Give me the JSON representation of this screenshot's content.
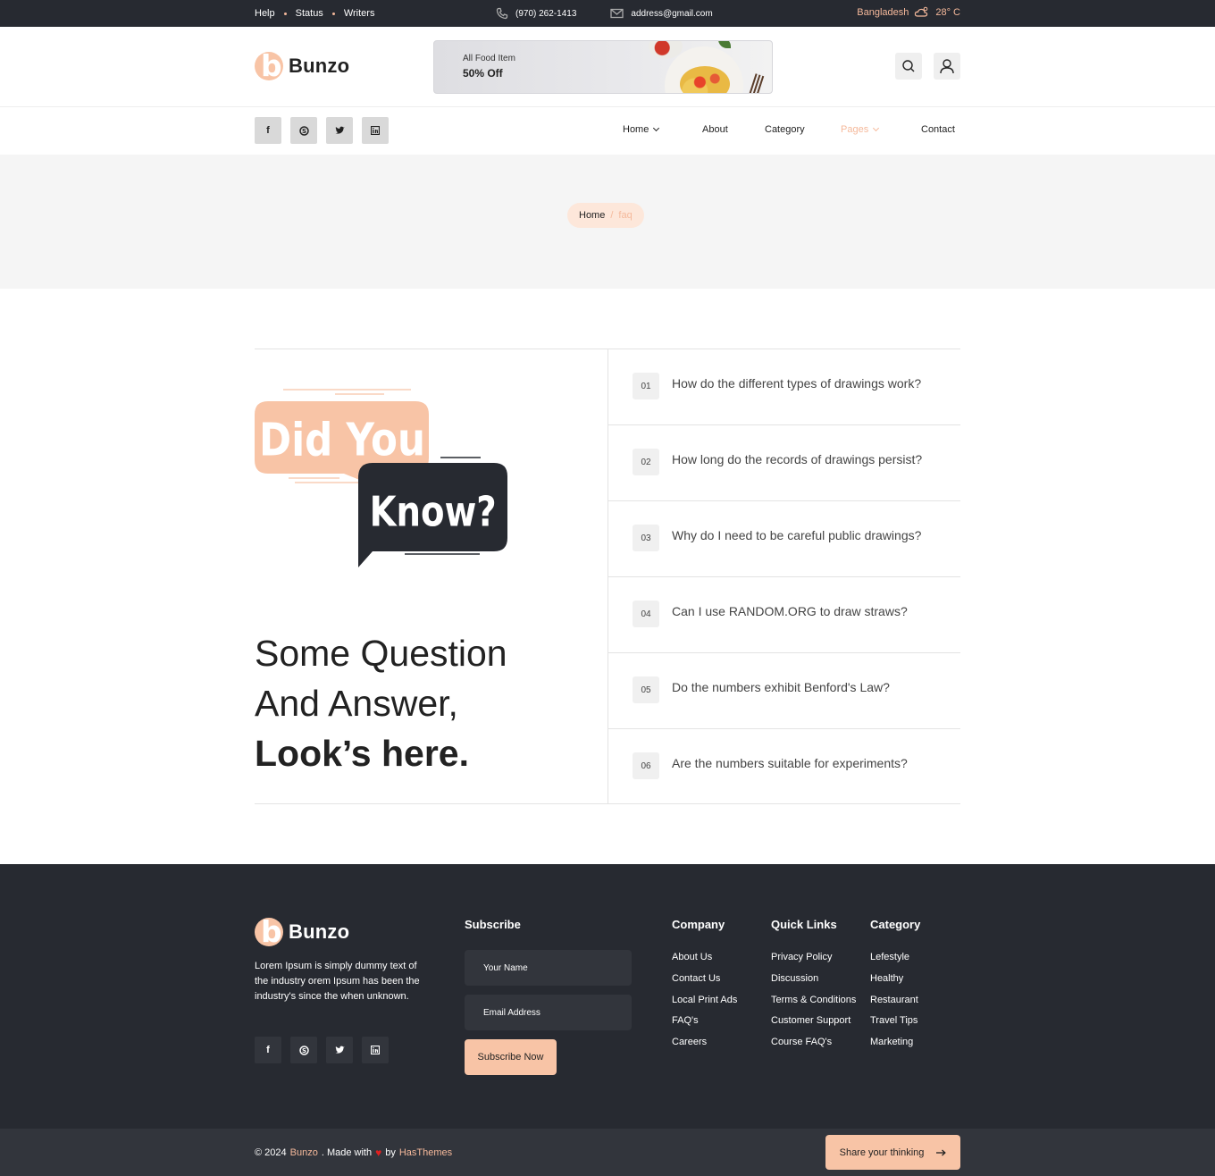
{
  "topbar": {
    "links": [
      "Help",
      "Status",
      "Writers"
    ],
    "phone": "(970) 262-1413",
    "email": "address@gmail.com",
    "location": "Bangladesh",
    "temperature": "28° C"
  },
  "brand": {
    "name": "Bunzo"
  },
  "promo": {
    "small": "All Food Item",
    "big": "50% Off"
  },
  "nav": {
    "items": [
      "Home",
      "About",
      "Category",
      "Pages",
      "Contact"
    ],
    "active": "Pages"
  },
  "breadcrumb": {
    "home": "Home",
    "sep": "/",
    "current": "faq"
  },
  "faq": {
    "badge_line1": "Did You",
    "badge_line2": "Know?",
    "headline_line1": "Some Question",
    "headline_line2": "And Answer,",
    "headline_line3": "Look’s here.",
    "items": [
      {
        "num": "01",
        "q": "How do the different types of drawings work?"
      },
      {
        "num": "02",
        "q": "How long do the records of drawings persist?"
      },
      {
        "num": "03",
        "q": "Why do I need to be careful public drawings?"
      },
      {
        "num": "04",
        "q": "Can I use RANDOM.ORG to draw straws?"
      },
      {
        "num": "05",
        "q": "Do the numbers exhibit Benford's Law?"
      },
      {
        "num": "06",
        "q": "Are the numbers suitable for experiments?"
      }
    ]
  },
  "footer": {
    "description": "Lorem Ipsum is simply dummy text of the industry orem Ipsum has been the industry's since the when unknown.",
    "subscribe": {
      "title": "Subscribe",
      "name_placeholder": "Your Name",
      "email_placeholder": "Email Address",
      "button": "Subscribe Now"
    },
    "company": {
      "title": "Company",
      "links": [
        "About Us",
        "Contact Us",
        "Local Print Ads",
        "FAQ's",
        "Careers"
      ]
    },
    "quick_links": {
      "title": "Quick Links",
      "links": [
        "Privacy Policy",
        "Discussion",
        "Terms & Conditions",
        "Customer Support",
        "Course FAQ's"
      ]
    },
    "category": {
      "title": "Category",
      "links": [
        "Lefestyle",
        "Healthy",
        "Restaurant",
        "Travel Tips",
        "Marketing"
      ]
    }
  },
  "bottom": {
    "copyright": "© 2024",
    "brand": "Bunzo",
    "made_with": ". Made with",
    "by": "by",
    "author": "HasThemes",
    "share_button": "Share your thinking"
  },
  "colors": {
    "accent": "#f8c4a6",
    "dark": "#272a31",
    "active_nav": "#f5b99b"
  }
}
